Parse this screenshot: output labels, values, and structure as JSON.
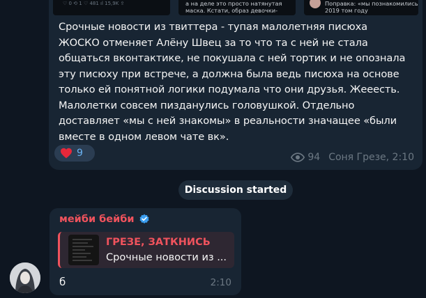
{
  "preview": {
    "thumb1_stats": "♡ 0   ⟲ 1   ♡ 481   ıl 15,9K   ⇪",
    "thumb2_text": "а на деле это просто натянутая\nмаска. Кстати, образ девочки-",
    "thumb3_text": "Поправка: «мы познакомились в\n2019 том году"
  },
  "post": {
    "text": "Срочные новости из твиттера - тупая малолетняя писюха\nЖОСКО отменяет Алёну Швец за то что та с ней не стала\nобщаться вконтактике, не покушала с ней тортик и не опознала\nэту писюху при встрече, а должна была ведь писюха на основе\nтолько ей понятной логики подумала что они друзья. Жееесть.\nМалолетки совсем пизданулись головушкой. Отдельно\nдоставляет «мы с ней знакомы» в реальности значащее «были\nвместе в одном левом чате вк».",
    "reaction_count": "9",
    "views": "94",
    "signature": "Соня Грезе, 2:10",
    "reaction_icon": "heart-icon",
    "eye_icon": "eye-icon"
  },
  "service": {
    "label": "Discussion started"
  },
  "reply": {
    "sender": "мейби бейби",
    "quote_title": "ГРЕЗЕ, ЗАТКНИСЬ",
    "quote_text": "Срочные новости из ...",
    "text": "б",
    "time": "2:10",
    "verified_icon": "verified-icon"
  },
  "colors": {
    "background": "#0e1621",
    "bubble": "#182533",
    "accent_red": "#f0535d",
    "link_blue": "#6ab2f2",
    "meta_gray": "#6c7883"
  }
}
